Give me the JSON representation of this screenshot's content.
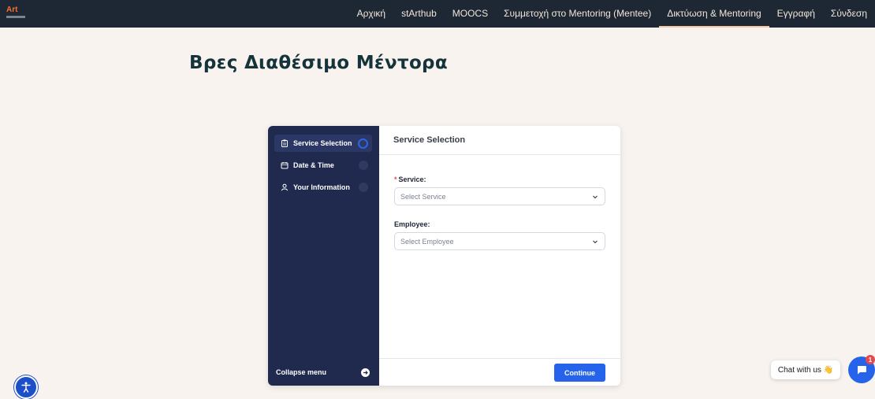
{
  "header": {
    "logo_text": "Art",
    "nav": [
      {
        "label": "Αρχική"
      },
      {
        "label": "stArthub"
      },
      {
        "label": "MOOCS"
      },
      {
        "label": "Συμμετοχή στο Mentoring (Mentee)"
      },
      {
        "label": "Δικτύωση & Mentoring",
        "active": true
      },
      {
        "label": "Εγγραφή"
      },
      {
        "label": "Σύνδεση"
      }
    ]
  },
  "page": {
    "title": "Βρες Διαθέσιμο Μέντορα"
  },
  "booking": {
    "sidebar": {
      "steps": [
        {
          "label": "Service Selection",
          "icon": "clipboard-icon",
          "active": true
        },
        {
          "label": "Date & Time",
          "icon": "calendar-icon",
          "active": false
        },
        {
          "label": "Your Information",
          "icon": "user-icon",
          "active": false
        }
      ],
      "collapse_label": "Collapse menu"
    },
    "main": {
      "heading": "Service Selection",
      "service": {
        "label": "Service:",
        "required_mark": "*",
        "placeholder": "Select Service"
      },
      "employee": {
        "label": "Employee:",
        "placeholder": "Select Employee"
      },
      "continue_label": "Continue"
    }
  },
  "chat": {
    "bubble_text": "Chat with us 👋",
    "badge_count": "1"
  },
  "colors": {
    "topbar": "#1e2734",
    "page_bg": "#f8f3ef",
    "sidebar": "#1f2a4e",
    "primary": "#2563eb",
    "title": "#14333b"
  }
}
